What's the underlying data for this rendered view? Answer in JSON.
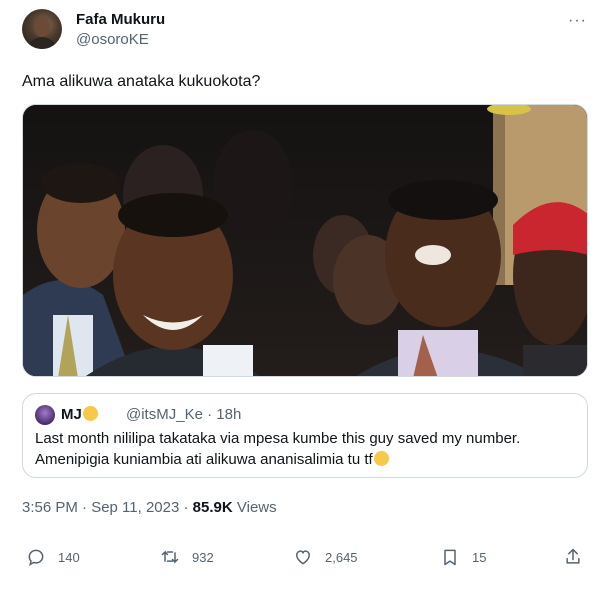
{
  "tweet": {
    "author": {
      "display_name": "Fafa Mukuru",
      "handle": "@osoroKE",
      "avatar_icon": "profile-photo"
    },
    "more_label": "···",
    "text": "Ama alikuwa anataka kukuokota?",
    "media": {
      "kind": "photo",
      "description_icon": "photo-image"
    },
    "quoted": {
      "display_name": "MJ",
      "display_emoji_icon": "smiling-face-with-hearts-emoji",
      "handle": "@itsMJ_Ke",
      "separator": "·",
      "time": "18h",
      "line1": "Last month nililipa takataka via mpesa kumbe this guy saved my number.",
      "line2": "Amenipigia kuniambia ati alikuwa ananisalimia tu tf",
      "line2_emoji_icon": "pleading-face-emoji"
    },
    "timestamp": "3:56 PM · Sep 11, 2023 ·",
    "views_count": "85.9K",
    "views_label": "Views",
    "actions": {
      "replies": "140",
      "reposts": "932",
      "likes": "2,645",
      "bookmarks": "15"
    },
    "colors": {
      "text_primary": "#0f1419",
      "text_secondary": "#536471",
      "border": "#cfd9de"
    }
  }
}
